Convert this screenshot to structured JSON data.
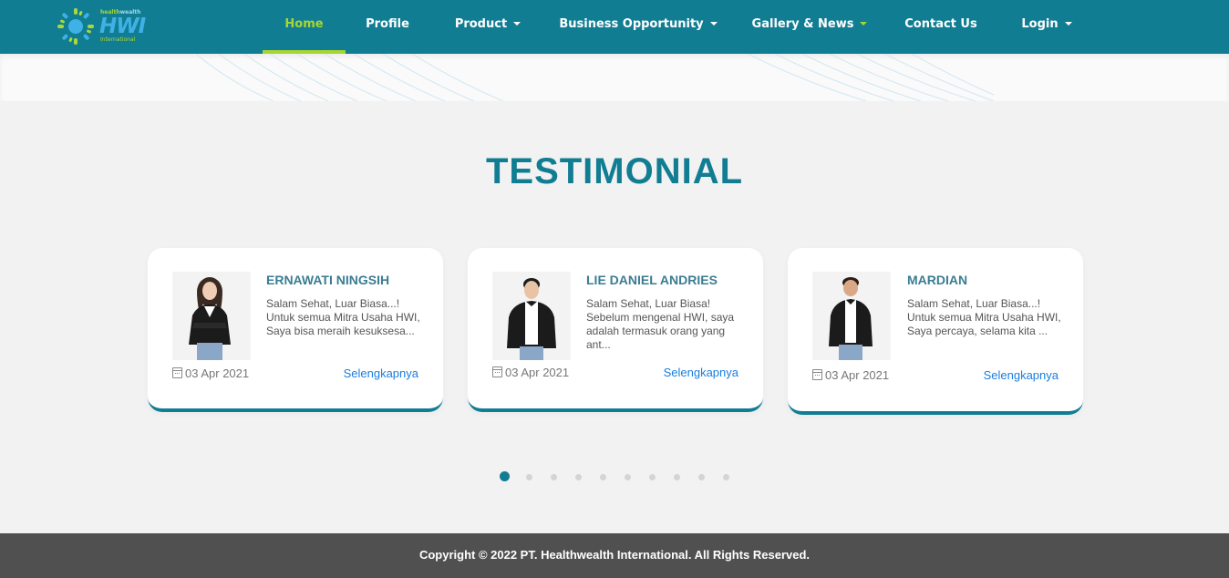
{
  "brand": {
    "logo_small_a": "health",
    "logo_small_b": "wealth",
    "logo_big": "HWI",
    "logo_intl": "International"
  },
  "nav": {
    "items": [
      {
        "label": "Home",
        "active": true,
        "dropdown": false
      },
      {
        "label": "Profile",
        "active": false,
        "dropdown": false
      },
      {
        "label": "Product",
        "active": false,
        "dropdown": true
      },
      {
        "label": "Business Opportunity",
        "active": false,
        "dropdown": true
      },
      {
        "label": "Gallery & News",
        "active": false,
        "dropdown": true
      },
      {
        "label": "Contact Us",
        "active": false,
        "dropdown": false
      },
      {
        "label": "Login",
        "active": false,
        "dropdown": true
      }
    ]
  },
  "section": {
    "title": "TESTIMONIAL"
  },
  "testimonials": [
    {
      "name": "ERNAWATI NINGSIH",
      "excerpt": "Salam Sehat, Luar Biasa...! Untuk semua Mitra Usaha HWI, Saya bisa meraih kesuksesa...",
      "date": "03 Apr 2021",
      "link": "Selengkapnya"
    },
    {
      "name": "LIE DANIEL ANDRIES",
      "excerpt": "Salam Sehat, Luar Biasa! Sebelum mengenal HWI, saya adalah termasuk orang yang ant...",
      "date": "03 Apr 2021",
      "link": "Selengkapnya"
    },
    {
      "name": "MARDIAN",
      "excerpt": "Salam Sehat, Luar Biasa...! Untuk semua Mitra Usaha HWI, Saya percaya, selama kita ...",
      "date": "03 Apr 2021",
      "link": "Selengkapnya"
    }
  ],
  "carousel": {
    "active_index": 0,
    "count": 10
  },
  "footer": {
    "copyright": "Copyright © 2022 PT. Healthwealth International. All Rights Reserved."
  },
  "colors": {
    "primary": "#117d93",
    "accent": "#a7d631",
    "link": "#1a7ee0",
    "footer_bg": "#505050"
  }
}
